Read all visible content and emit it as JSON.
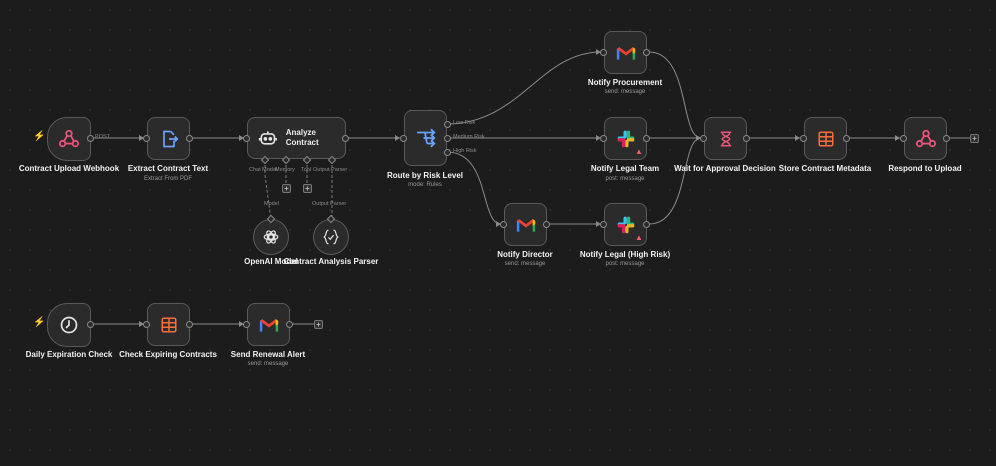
{
  "workflow": {
    "nodes": {
      "contract_upload_webhook": {
        "label": "Contract Upload Webhook",
        "icon": "webhook-icon"
      },
      "extract_contract_text": {
        "label": "Extract Contract Text",
        "subtitle": "Extract From PDF",
        "icon": "file-export-icon"
      },
      "analyze_contract": {
        "label": "Analyze Contract",
        "icon": "robot-icon"
      },
      "route_by_risk": {
        "label": "Route by Risk Level",
        "subtitle": "mode: Rules",
        "icon": "switch-icon"
      },
      "notify_procurement": {
        "label": "Notify Procurement",
        "subtitle": "send: message",
        "icon": "gmail-icon"
      },
      "notify_legal_team": {
        "label": "Notify Legal Team",
        "subtitle": "post: message",
        "icon": "slack-icon"
      },
      "notify_director": {
        "label": "Notify Director",
        "subtitle": "send: message",
        "icon": "gmail-icon"
      },
      "notify_legal_high": {
        "label": "Notify Legal (High Risk)",
        "subtitle": "post: message",
        "icon": "slack-icon"
      },
      "wait_for_approval": {
        "label": "Wait for Approval Decision",
        "icon": "hourglass-icon"
      },
      "store_contract_metadata": {
        "label": "Store Contract Metadata",
        "icon": "table-icon"
      },
      "respond_to_upload": {
        "label": "Respond to Upload",
        "icon": "webhook-icon"
      },
      "openai_model": {
        "label": "OpenAI Model",
        "icon": "openai-icon"
      },
      "contract_analysis_parser": {
        "label": "Contract Analysis Parser",
        "icon": "braces-icon"
      },
      "daily_expiration_check": {
        "label": "Daily Expiration Check",
        "icon": "clock-icon"
      },
      "check_expiring_contracts": {
        "label": "Check Expiring Contracts",
        "icon": "table-icon"
      },
      "send_renewal_alert": {
        "label": "Send Renewal Alert",
        "subtitle": "send: message",
        "icon": "gmail-icon"
      }
    },
    "edge_labels": {
      "post": "POST",
      "low_risk": "Low Risk",
      "medium_risk": "Medium Risk",
      "high_risk": "High Risk",
      "chat_model": "Chat Model",
      "memory": "Memory",
      "tool": "Tool",
      "output_parser": "Output Parser",
      "model": "Model",
      "output_parser_2": "Output Parser"
    },
    "colors": {
      "trigger_bolt": "#ff6d3a",
      "table_orange": "#ff6d3a",
      "webhook_pink": "#e9547a",
      "switch_blue": "#6ba4ff",
      "warning_red": "#ff5c5c"
    }
  }
}
